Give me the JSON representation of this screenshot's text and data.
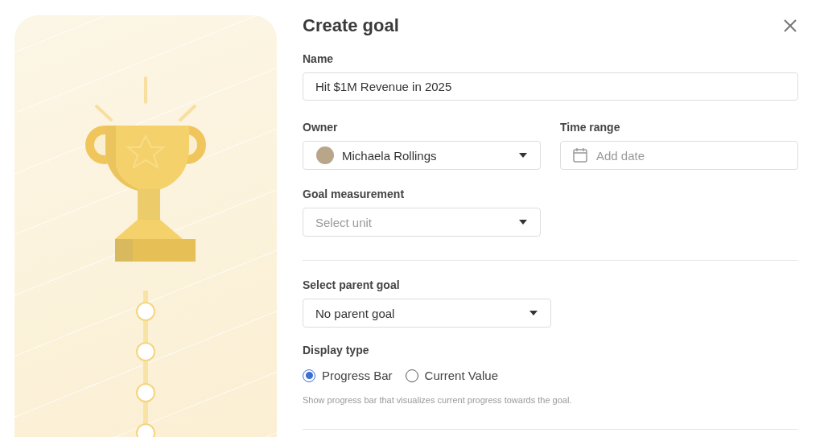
{
  "dialog": {
    "title": "Create goal"
  },
  "name_field": {
    "label": "Name",
    "value": "Hit $1M Revenue in 2025"
  },
  "owner_field": {
    "label": "Owner",
    "value": "Michaela Rollings"
  },
  "time_range_field": {
    "label": "Time range",
    "placeholder": "Add date"
  },
  "measurement_field": {
    "label": "Goal measurement",
    "placeholder": "Select unit"
  },
  "parent_goal_field": {
    "label": "Select parent goal",
    "value": "No parent goal"
  },
  "display_type": {
    "label": "Display type",
    "hint": "Show progress bar that visualizes current progress towards the goal.",
    "options": [
      {
        "label": "Progress Bar",
        "selected": true
      },
      {
        "label": "Current Value",
        "selected": false
      }
    ]
  }
}
